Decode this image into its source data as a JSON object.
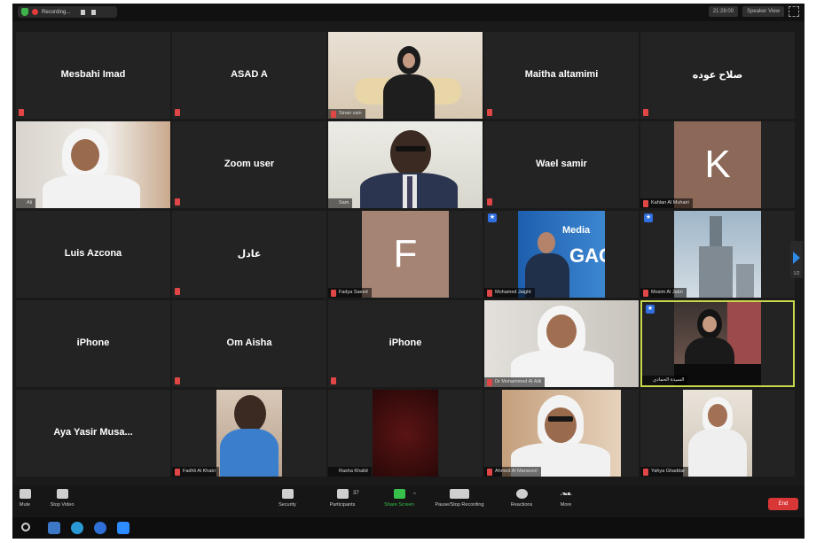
{
  "topbar": {
    "recording_label": "Recording...",
    "clock_text": "21:28:00",
    "view_label": "Speaker View"
  },
  "participants": [
    {
      "name": "Mesbahi Imad",
      "video": false
    },
    {
      "name": "ASAD A",
      "video": false
    },
    {
      "name": "Sinan zain",
      "video": true
    },
    {
      "name": "Maitha altamimi",
      "video": false
    },
    {
      "name": "صلاح عوده",
      "video": false
    },
    {
      "name": "Ali",
      "video": true
    },
    {
      "name": "Zoom user",
      "video": false
    },
    {
      "name": "Sam",
      "video": true
    },
    {
      "name": "Wael samir",
      "video": false
    },
    {
      "name": "Kahlan Al Muhairi",
      "video": true,
      "avatar_letter": "K"
    },
    {
      "name": "Luis Azcona",
      "video": false
    },
    {
      "name": "عادل",
      "video": false
    },
    {
      "name": "Fadya Saeed",
      "video": true,
      "avatar_letter": "F"
    },
    {
      "name": "Mohamed Jaight",
      "video": true
    },
    {
      "name": "Mosim Al Jabri",
      "video": true
    },
    {
      "name": "iPhone",
      "video": false
    },
    {
      "name": "Om Aisha",
      "video": false
    },
    {
      "name": "iPhone",
      "video": false
    },
    {
      "name": "Dr Mohammed Al Alili",
      "video": true
    },
    {
      "name": "السيدة الحمادي",
      "video": true
    },
    {
      "name": "Aya Yasir Musa...",
      "video": false
    },
    {
      "name": "Fadhli Al Khatri",
      "video": true
    },
    {
      "name": "Rasha Khalid",
      "video": true
    },
    {
      "name": "Ahmed Al Mansoori",
      "video": true
    },
    {
      "name": "Yahya Ghaddar",
      "video": true
    }
  ],
  "banner_text": {
    "brand_top": "Media",
    "brand_big": "GAC"
  },
  "side_nav": {
    "page_text": "1/2"
  },
  "toolbar": {
    "mute": "Mute",
    "stop_video": "Stop Video",
    "security": "Security",
    "participants": "Participants",
    "participants_count": "37",
    "share_screen": "Share Screen",
    "pause_recording": "Pause/Stop Recording",
    "reactions": "Reactions",
    "more": "More",
    "end": "End"
  },
  "colors": {
    "tile_bg": "#232323",
    "active_border": "#c9d84b",
    "mute_red": "#e04646",
    "share_green": "#37c14a",
    "end_red": "#d93636",
    "avatar_brown": "#a07f70"
  }
}
